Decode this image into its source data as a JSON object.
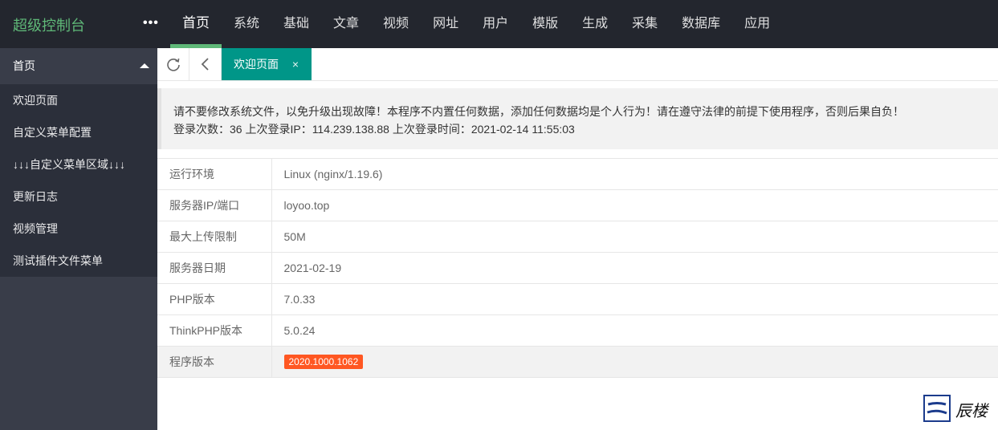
{
  "header": {
    "logo": "超级控制台",
    "more": "•••",
    "nav": [
      "首页",
      "系统",
      "基础",
      "文章",
      "视频",
      "网址",
      "用户",
      "模版",
      "生成",
      "采集",
      "数据库",
      "应用"
    ]
  },
  "sidebar": {
    "head": "首页",
    "items": [
      "欢迎页面",
      "自定义菜单配置",
      "↓↓↓自定义菜单区域↓↓↓",
      "更新日志",
      "视频管理",
      "测试插件文件菜单"
    ]
  },
  "tabs": {
    "refresh_icon": "refresh-icon",
    "back_icon": "chevron-left-icon",
    "active_label": "欢迎页面",
    "close": "×"
  },
  "notice": {
    "line1": "请不要修改系统文件，以免升级出现故障！本程序不内置任何数据，添加任何数据均是个人行为！请在遵守法律的前提下使用程序，否则后果自负！",
    "line2": "登录次数：36 上次登录IP：114.239.138.88 上次登录时间：2021-02-14 11:55:03"
  },
  "info": [
    {
      "key": "运行环境",
      "value": "Linux (nginx/1.19.6)"
    },
    {
      "key": "服务器IP/端口",
      "value": "loyoo.top"
    },
    {
      "key": "最大上传限制",
      "value": "50M"
    },
    {
      "key": "服务器日期",
      "value": "2021-02-19"
    },
    {
      "key": "PHP版本",
      "value": "7.0.33"
    },
    {
      "key": "ThinkPHP版本",
      "value": "5.0.24"
    }
  ],
  "version": {
    "key": "程序版本",
    "value": "2020.1000.1062"
  },
  "watermark": {
    "text": "辰楼"
  },
  "colors": {
    "accent": "#5fb878",
    "tab": "#009688",
    "badge": "#ff5722",
    "sidebar": "#393d49",
    "header": "#23262e"
  }
}
